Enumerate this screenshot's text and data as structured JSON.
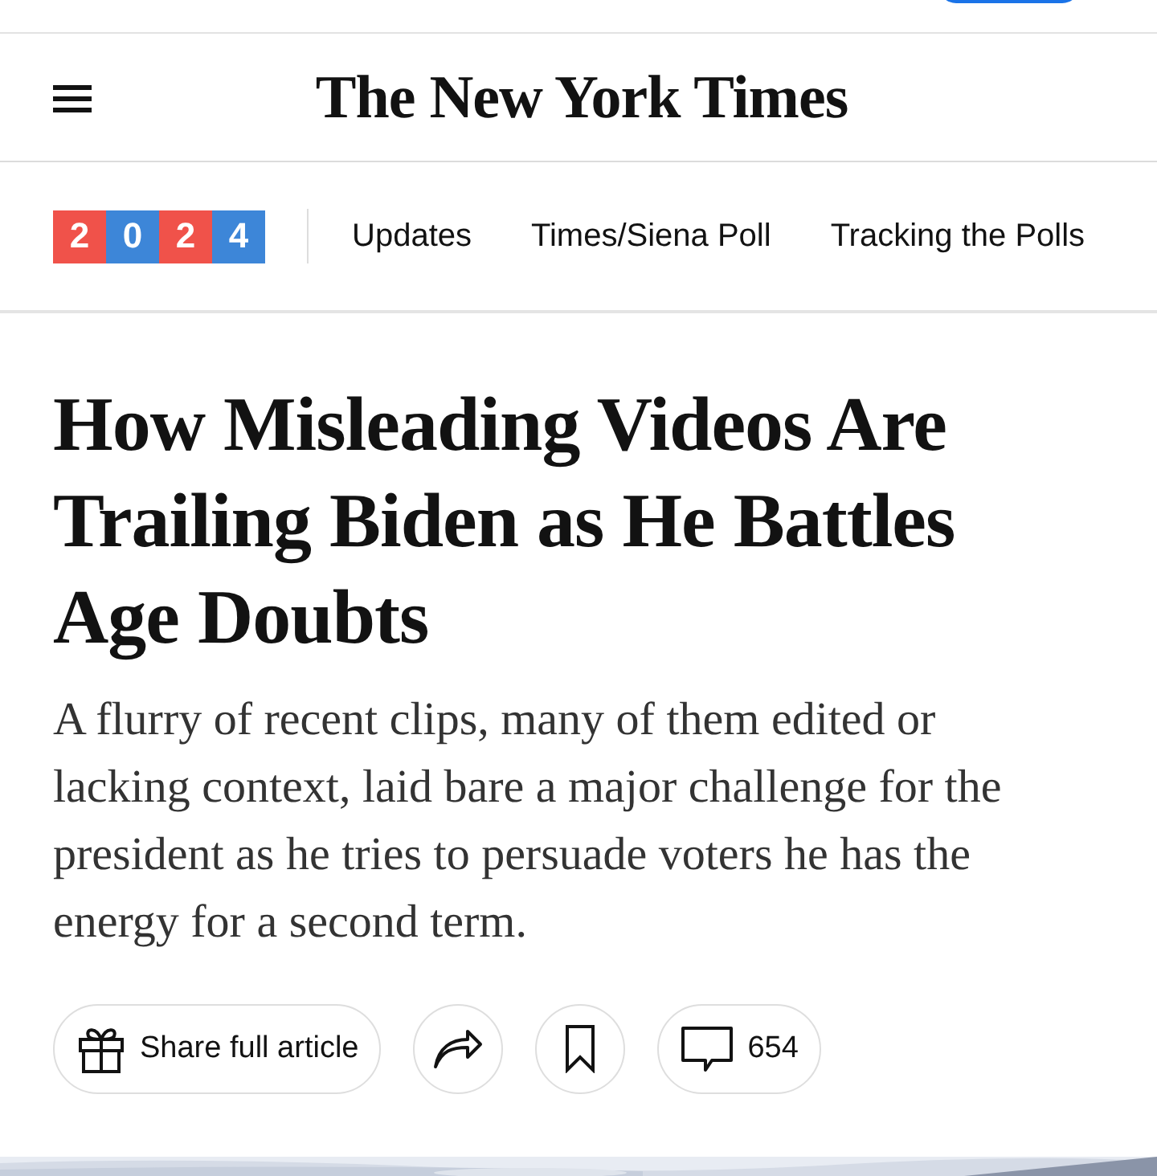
{
  "masthead": {
    "logo": "The New York Times"
  },
  "section_nav": {
    "badge": [
      {
        "digit": "2",
        "color": "#f0524a"
      },
      {
        "digit": "0",
        "color": "#3d86d8"
      },
      {
        "digit": "2",
        "color": "#f0524a"
      },
      {
        "digit": "4",
        "color": "#3d86d8"
      }
    ],
    "links": [
      "Updates",
      "Times/Siena Poll",
      "Tracking the Polls"
    ]
  },
  "article": {
    "headline": "How Misleading Videos Are Trailing Biden as He Battles Age Doubts",
    "summary": "A flurry of recent clips, many of them edited or lacking context, laid bare a major challenge for the president as he tries to persuade voters he has the energy for a second term.",
    "actions": [
      {
        "kind": "gift",
        "label": "Share full article"
      },
      {
        "kind": "share"
      },
      {
        "kind": "save"
      },
      {
        "kind": "comments",
        "label": "654"
      }
    ]
  }
}
